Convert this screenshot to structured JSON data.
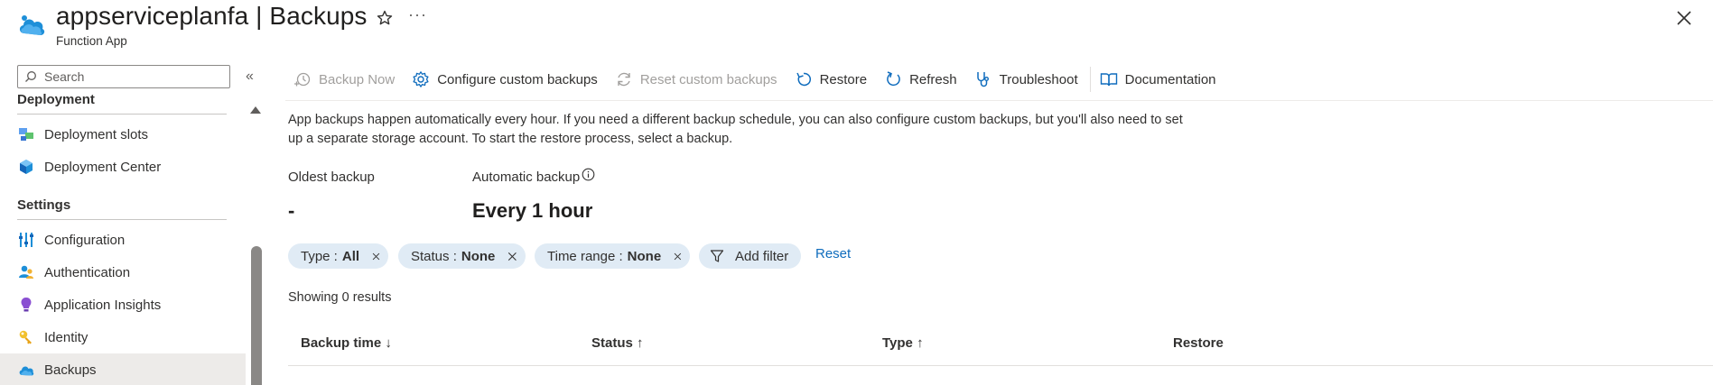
{
  "header": {
    "title": "appserviceplanfa | Backups",
    "subtitle": "Function App",
    "more": "···"
  },
  "sidebar": {
    "search_placeholder": "Search",
    "collapse": "«",
    "partial_section": "Deployment",
    "settings_section": "Settings",
    "items": [
      {
        "label": "Deployment slots"
      },
      {
        "label": "Deployment Center"
      },
      {
        "label": "Configuration"
      },
      {
        "label": "Authentication"
      },
      {
        "label": "Application Insights"
      },
      {
        "label": "Identity"
      },
      {
        "label": "Backups"
      }
    ]
  },
  "toolbar": {
    "backup_now": "Backup Now",
    "configure": "Configure custom backups",
    "reset_custom": "Reset custom backups",
    "restore": "Restore",
    "refresh": "Refresh",
    "troubleshoot": "Troubleshoot",
    "documentation": "Documentation"
  },
  "description": "App backups happen automatically every hour. If you need a different backup schedule, you can also configure custom backups, but you'll also need to set up a separate storage account. To start the restore process, select a backup.",
  "summary": {
    "oldest_label": "Oldest backup",
    "oldest_value": "-",
    "auto_label": "Automatic backup",
    "auto_value": "Every 1 hour"
  },
  "filters": {
    "type_label": "Type :",
    "type_value": "All",
    "status_label": "Status :",
    "status_value": "None",
    "time_label": "Time range :",
    "time_value": "None",
    "add_filter": "Add filter",
    "reset": "Reset"
  },
  "results": "Showing 0 results",
  "table": {
    "headers": [
      "Backup time ↓",
      "Status ↑",
      "Type ↑",
      "Restore"
    ]
  },
  "colors": {
    "accent": "#0f6cbd",
    "pill_bg": "#e0ebf5",
    "active_nav": "#edebe9"
  }
}
